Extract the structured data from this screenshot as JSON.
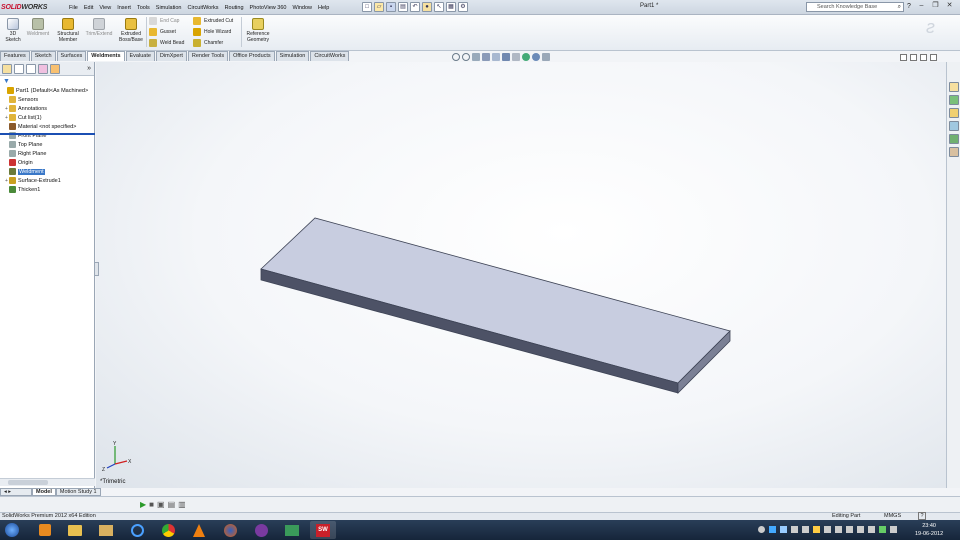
{
  "titlebar": {
    "logo_solid": "SOLID",
    "logo_works": "WORKS",
    "menu": [
      "File",
      "Edit",
      "View",
      "Insert",
      "Tools",
      "Simulation",
      "CircuitWorks",
      "Routing",
      "PhotoView 360",
      "Window",
      "Help"
    ],
    "document_title": "Part1 *",
    "search_placeholder": "Search Knowledge Base",
    "help_label": "?"
  },
  "command_manager": {
    "buttons": [
      {
        "label": "3D\nSketch",
        "icon": "3d-sketch-icon"
      },
      {
        "label": "Weldment",
        "icon": "weldment-icon"
      },
      {
        "label": "Structural\nMember",
        "icon": "structural-member-icon"
      },
      {
        "label": "Trim/Extend",
        "icon": "trim-extend-icon"
      },
      {
        "label": "Extruded\nBoss/Base",
        "icon": "extruded-boss-icon"
      }
    ],
    "small_col1": [
      {
        "label": "End Cap",
        "disabled": true
      },
      {
        "label": "Gusset",
        "disabled": false
      },
      {
        "label": "Weld Bead",
        "disabled": false
      }
    ],
    "small_col2": [
      {
        "label": "Extruded Cut"
      },
      {
        "label": "Hole Wizard"
      },
      {
        "label": "Chamfer"
      }
    ],
    "reference_geometry": "Reference\nGeometry"
  },
  "tabs": [
    "Features",
    "Sketch",
    "Surfaces",
    "Weldments",
    "Evaluate",
    "DimXpert",
    "Render Tools",
    "Office Products",
    "Simulation",
    "CircuitWorks"
  ],
  "active_tab": "Weldments",
  "feature_tree": {
    "items": [
      {
        "label": "Part1  (Default<As Machined>",
        "expand": "",
        "indent": 0,
        "color": "#d9a400"
      },
      {
        "label": "Sensors",
        "expand": "",
        "indent": 1,
        "color": "#e0b43a"
      },
      {
        "label": "Annotations",
        "expand": "+",
        "indent": 1,
        "color": "#e0b43a"
      },
      {
        "label": "Cut list(1)",
        "expand": "+",
        "indent": 1,
        "color": "#e0b43a"
      },
      {
        "label": "Material <not specified>",
        "expand": "",
        "indent": 1,
        "color": "#8a5a2b"
      },
      {
        "label": "Front Plane",
        "expand": "",
        "indent": 1,
        "color": "#9aa"
      },
      {
        "label": "Top Plane",
        "expand": "",
        "indent": 1,
        "color": "#9aa"
      },
      {
        "label": "Right Plane",
        "expand": "",
        "indent": 1,
        "color": "#9aa"
      },
      {
        "label": "Origin",
        "expand": "",
        "indent": 1,
        "color": "#c33"
      },
      {
        "label": "Weldment",
        "expand": "",
        "indent": 1,
        "color": "#6a7a3a",
        "selected": true
      },
      {
        "label": "Surface-Extrude1",
        "expand": "+",
        "indent": 1,
        "color": "#c9a020"
      },
      {
        "label": "Thicken1",
        "expand": "",
        "indent": 1,
        "color": "#4a8a3a"
      }
    ]
  },
  "graphics": {
    "view_label": "*Trimetric",
    "triad": {
      "x": "X",
      "y": "Y",
      "z": "Z"
    }
  },
  "bottom_tabs": [
    "Model",
    "Motion Study 1"
  ],
  "active_bottom_tab": "Model",
  "status_bar": {
    "product": "SolidWorks Premium 2012 x64 Edition",
    "mode": "Editing Part",
    "units": "MMGS",
    "help": "?"
  },
  "taskbar": {
    "time": "23:40",
    "date": "19-06-2012",
    "apps": [
      "start-icon",
      "media-player-icon",
      "explorer-icon",
      "folder-icon",
      "ie-icon",
      "chrome-icon",
      "vlc-icon",
      "firefox-icon",
      "tor-icon",
      "green-app-icon",
      "solidworks-icon"
    ]
  },
  "colors": {
    "plate_top": "#c8cde0",
    "plate_side": "#4d5266",
    "plate_front": "#7b8095",
    "tab_accent": "#3a78c8"
  }
}
